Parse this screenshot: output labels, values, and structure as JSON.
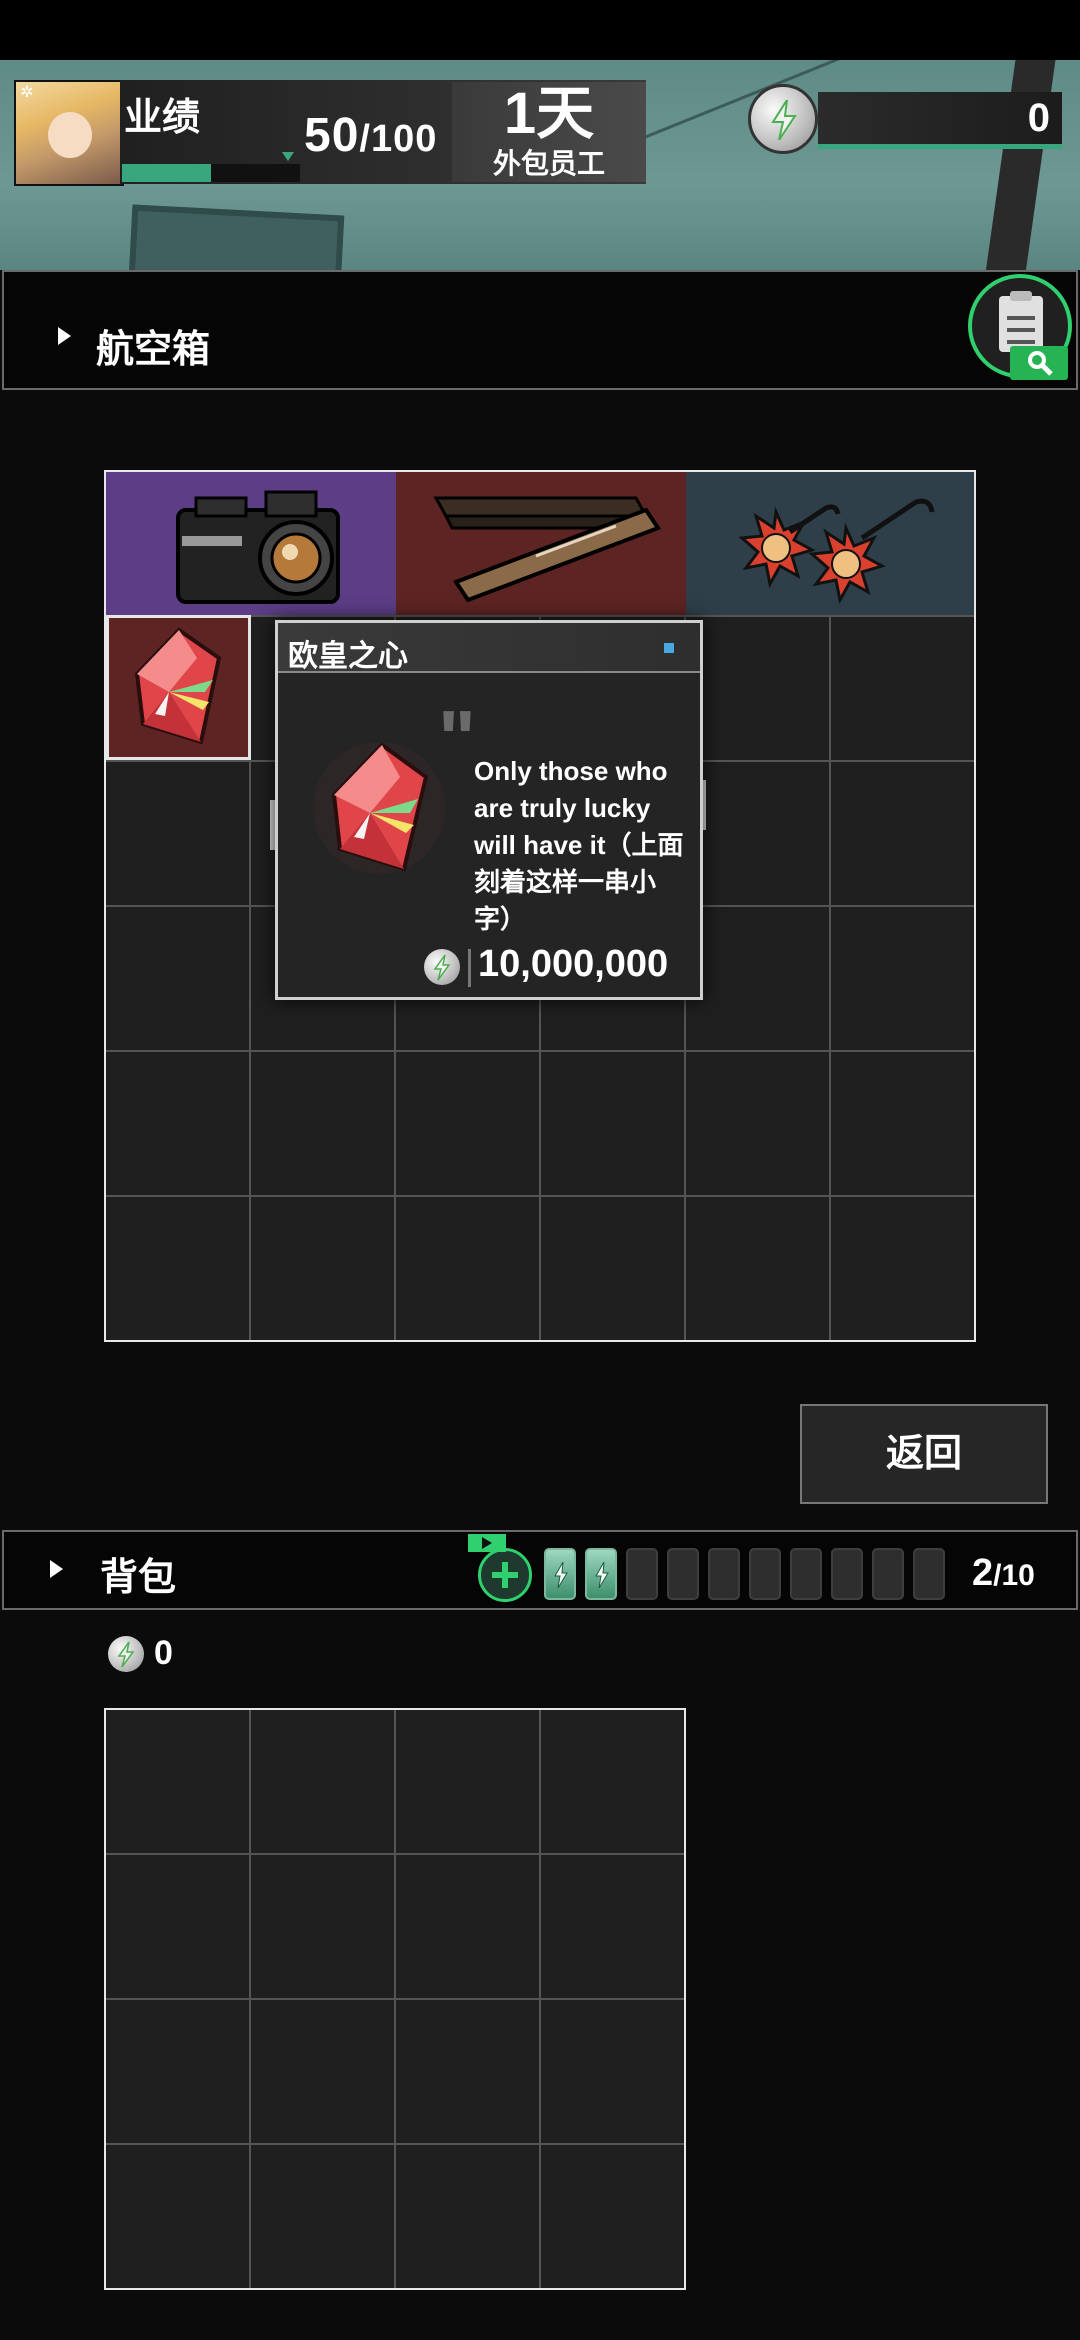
{
  "hud": {
    "performance_label": "业绩",
    "performance_current": "50",
    "performance_max": "/100",
    "performance_ratio": 0.5,
    "day_value": "1天",
    "day_label": "外包员工",
    "money": "0",
    "accent_color": "#39a77d"
  },
  "crate": {
    "title": "航空箱",
    "top_items": [
      {
        "name": "camera",
        "icon": "camera-icon",
        "bg": "#5c3d86"
      },
      {
        "name": "wooden-sign",
        "icon": "wooden-sign-icon",
        "bg": "#5e2424"
      },
      {
        "name": "sun-glasses",
        "icon": "sun-glasses-icon",
        "bg": "#2f3f4a"
      }
    ],
    "selected_item_icon": "red-crystal-icon",
    "selected_item_bg": "#5e2424"
  },
  "tooltip": {
    "title": "欧皇之心",
    "quote_mark": "\"",
    "description": "Only those who are truly lucky will have it（上面刻着这样一串小字）",
    "price": "10,000,000",
    "item_icon": "red-crystal-icon"
  },
  "actions": {
    "return_label": "返回"
  },
  "bag": {
    "title": "背包",
    "count_current": "2",
    "count_max": "/10",
    "batteries_full": 2,
    "batteries_total": 10,
    "money": "0"
  }
}
